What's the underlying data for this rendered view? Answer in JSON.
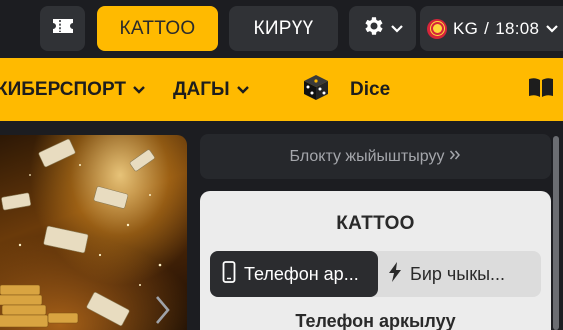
{
  "header": {
    "login_label": "КАТТОО",
    "register_label": "КИРҮҮ",
    "region_code": "KG",
    "region_separator": "/",
    "time": "18:08",
    "accent_color": "#ffba00"
  },
  "nav": {
    "esports_label": "КИБЕРСПОРТ",
    "more_label": "ДАГЫ",
    "dice_label": "Dice"
  },
  "sidebar": {
    "hide_block_label": "Блокту жыйыштыруу",
    "hide_block_icon": "double-chevron-right-icon"
  },
  "login_panel": {
    "title": "КАТТОО",
    "tabs": [
      {
        "label": "Телефон ар...",
        "icon": "smartphone-icon",
        "active": true
      },
      {
        "label": "Бир чыкы...",
        "icon": "lightning-icon",
        "active": false
      }
    ],
    "section_label": "Телефон аркылуу"
  }
}
